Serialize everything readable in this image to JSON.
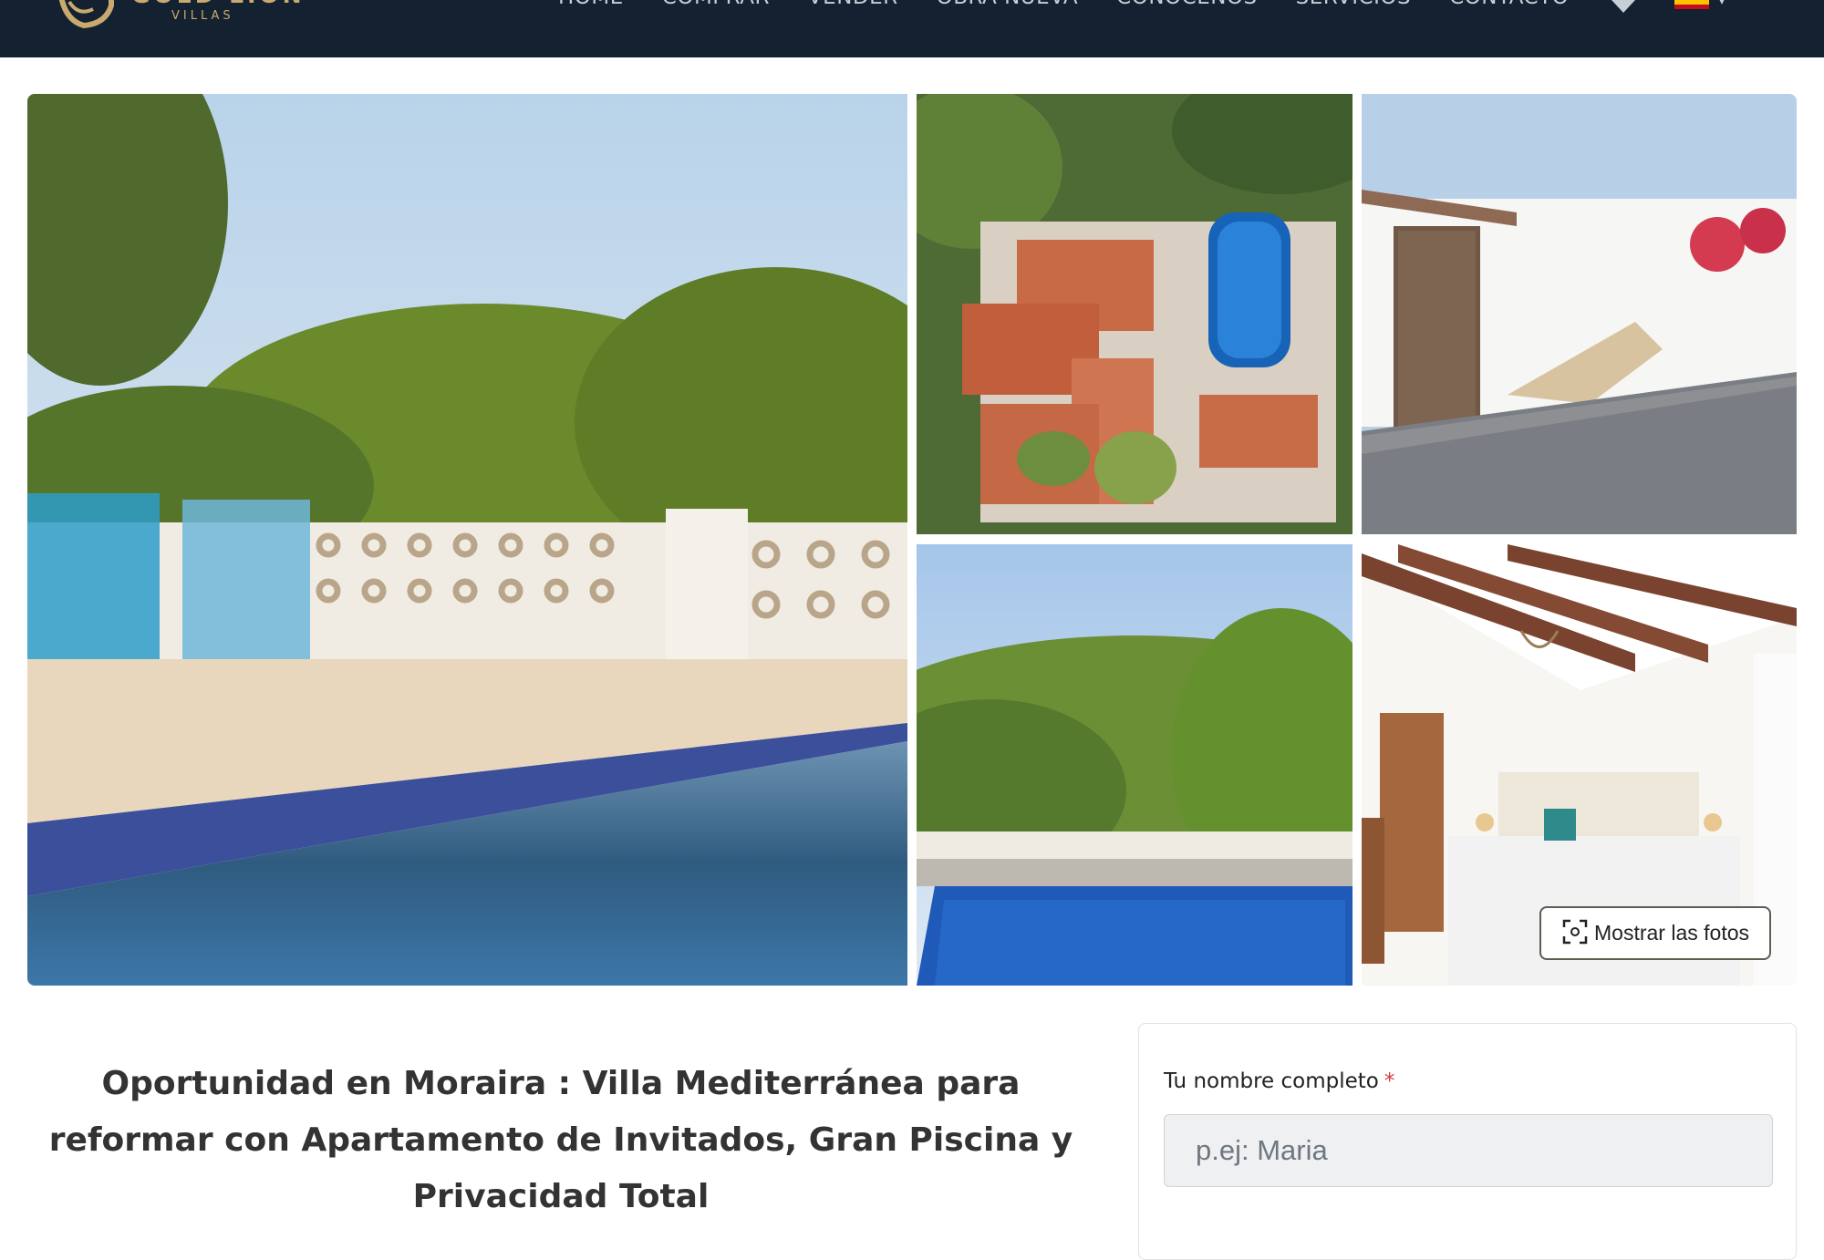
{
  "brand": {
    "name": "GOLD LION",
    "subtitle": "VILLAS",
    "color": "#c9a96e"
  },
  "nav": {
    "items": [
      "HOME",
      "COMPRAR",
      "VENDER",
      "OBRA NUEVA",
      "CONOCENOS",
      "SERVICIOS",
      "CONTACTO"
    ],
    "favorites_icon": "heart-icon",
    "language_flag": "spain-flag-icon"
  },
  "gallery": {
    "show_photos_label": "Mostrar las fotos",
    "show_photos_icon": "expand-icon"
  },
  "listing": {
    "title": "Oportunidad en Moraira : Villa Mediterránea para reformar con Apartamento de Invitados, Gran Piscina y Privacidad Total"
  },
  "contact_form": {
    "name_label": "Tu nombre completo",
    "required_marker": "*",
    "name_placeholder": "p.ej: Maria"
  },
  "colors": {
    "header_bg": "#132130",
    "required": "#d9383a"
  }
}
